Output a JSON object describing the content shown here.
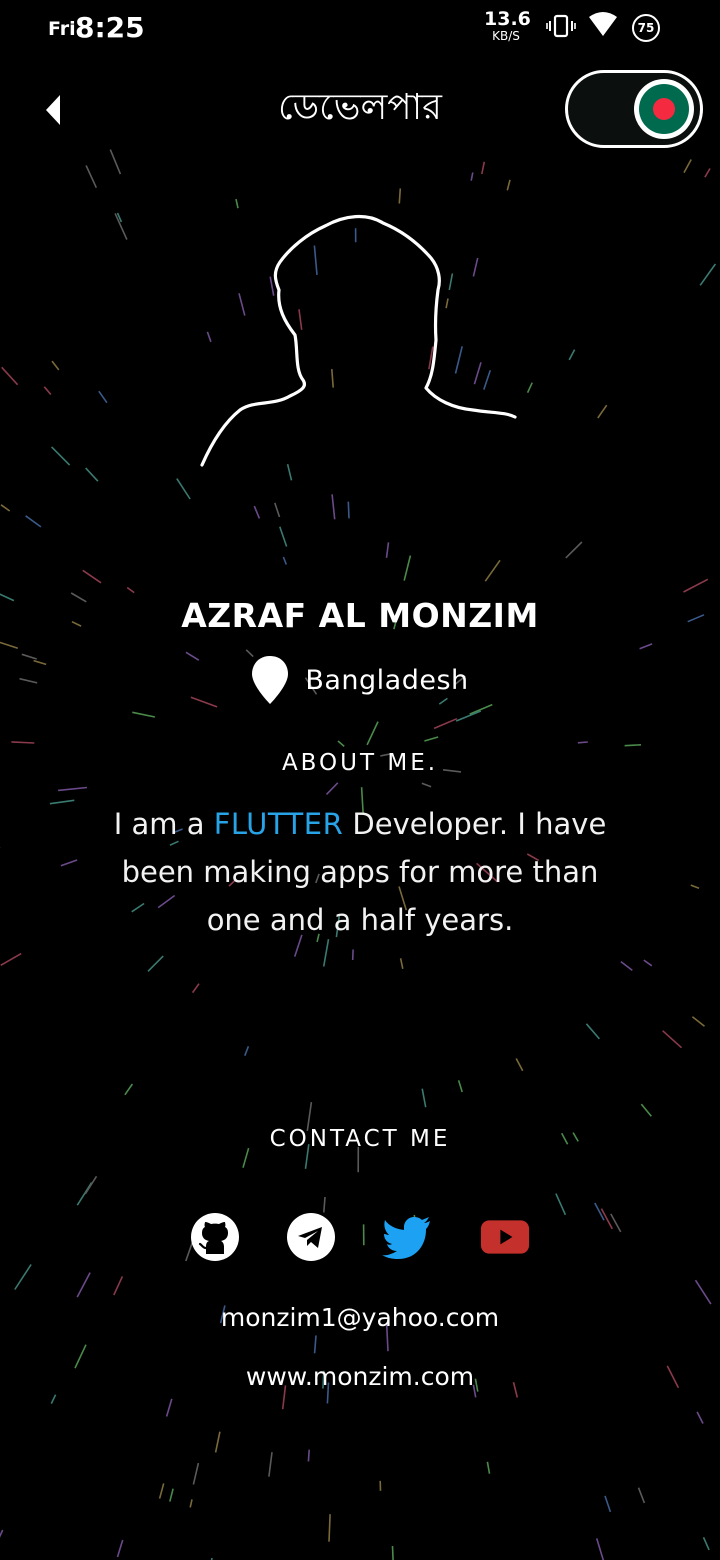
{
  "status_bar": {
    "day": "Fri",
    "time": "8:25",
    "net_speed": "13.6",
    "net_unit": "KB/S",
    "battery": "75",
    "icons": [
      "vibrate-icon",
      "wifi-icon",
      "battery-icon"
    ]
  },
  "header": {
    "back_icon": "back-arrow-icon",
    "title": "ডেভেলপার",
    "toggle_icon": "bangladesh-flag-icon",
    "toggle_on": true
  },
  "profile": {
    "name": "AZRAF AL MONZIM",
    "location_icon": "location-pin-icon",
    "location": "Bangladesh"
  },
  "about": {
    "heading": "ABOUT ME.",
    "text_before": "I am a ",
    "highlight": "FLUTTER",
    "text_after": " Developer. I have been making apps for more than one and a half years."
  },
  "contact": {
    "heading": "CONTACT ME",
    "socials": [
      "github-icon",
      "telegram-icon",
      "twitter-icon",
      "youtube-icon"
    ],
    "email": "monzim1@yahoo.com",
    "website": "www.monzim.com"
  },
  "colors": {
    "background": "#000000",
    "accent": "#29a3e8",
    "twitter": "#1da1f2",
    "youtube": "#c4302b",
    "flag_green": "#006a4e",
    "flag_red": "#f42a41"
  }
}
